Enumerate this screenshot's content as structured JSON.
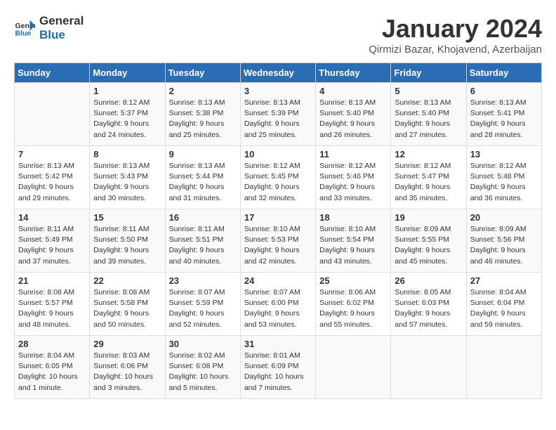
{
  "logo": {
    "line1": "General",
    "line2": "Blue"
  },
  "title": "January 2024",
  "location": "Qirmizi Bazar, Khojavend, Azerbaijan",
  "headers": [
    "Sunday",
    "Monday",
    "Tuesday",
    "Wednesday",
    "Thursday",
    "Friday",
    "Saturday"
  ],
  "weeks": [
    [
      {
        "day": "",
        "sunrise": "",
        "sunset": "",
        "daylight": ""
      },
      {
        "day": "1",
        "sunrise": "Sunrise: 8:12 AM",
        "sunset": "Sunset: 5:37 PM",
        "daylight": "Daylight: 9 hours and 24 minutes."
      },
      {
        "day": "2",
        "sunrise": "Sunrise: 8:13 AM",
        "sunset": "Sunset: 5:38 PM",
        "daylight": "Daylight: 9 hours and 25 minutes."
      },
      {
        "day": "3",
        "sunrise": "Sunrise: 8:13 AM",
        "sunset": "Sunset: 5:39 PM",
        "daylight": "Daylight: 9 hours and 25 minutes."
      },
      {
        "day": "4",
        "sunrise": "Sunrise: 8:13 AM",
        "sunset": "Sunset: 5:40 PM",
        "daylight": "Daylight: 9 hours and 26 minutes."
      },
      {
        "day": "5",
        "sunrise": "Sunrise: 8:13 AM",
        "sunset": "Sunset: 5:40 PM",
        "daylight": "Daylight: 9 hours and 27 minutes."
      },
      {
        "day": "6",
        "sunrise": "Sunrise: 8:13 AM",
        "sunset": "Sunset: 5:41 PM",
        "daylight": "Daylight: 9 hours and 28 minutes."
      }
    ],
    [
      {
        "day": "7",
        "sunrise": "Sunrise: 8:13 AM",
        "sunset": "Sunset: 5:42 PM",
        "daylight": "Daylight: 9 hours and 29 minutes."
      },
      {
        "day": "8",
        "sunrise": "Sunrise: 8:13 AM",
        "sunset": "Sunset: 5:43 PM",
        "daylight": "Daylight: 9 hours and 30 minutes."
      },
      {
        "day": "9",
        "sunrise": "Sunrise: 8:13 AM",
        "sunset": "Sunset: 5:44 PM",
        "daylight": "Daylight: 9 hours and 31 minutes."
      },
      {
        "day": "10",
        "sunrise": "Sunrise: 8:12 AM",
        "sunset": "Sunset: 5:45 PM",
        "daylight": "Daylight: 9 hours and 32 minutes."
      },
      {
        "day": "11",
        "sunrise": "Sunrise: 8:12 AM",
        "sunset": "Sunset: 5:46 PM",
        "daylight": "Daylight: 9 hours and 33 minutes."
      },
      {
        "day": "12",
        "sunrise": "Sunrise: 8:12 AM",
        "sunset": "Sunset: 5:47 PM",
        "daylight": "Daylight: 9 hours and 35 minutes."
      },
      {
        "day": "13",
        "sunrise": "Sunrise: 8:12 AM",
        "sunset": "Sunset: 5:48 PM",
        "daylight": "Daylight: 9 hours and 36 minutes."
      }
    ],
    [
      {
        "day": "14",
        "sunrise": "Sunrise: 8:11 AM",
        "sunset": "Sunset: 5:49 PM",
        "daylight": "Daylight: 9 hours and 37 minutes."
      },
      {
        "day": "15",
        "sunrise": "Sunrise: 8:11 AM",
        "sunset": "Sunset: 5:50 PM",
        "daylight": "Daylight: 9 hours and 39 minutes."
      },
      {
        "day": "16",
        "sunrise": "Sunrise: 8:11 AM",
        "sunset": "Sunset: 5:51 PM",
        "daylight": "Daylight: 9 hours and 40 minutes."
      },
      {
        "day": "17",
        "sunrise": "Sunrise: 8:10 AM",
        "sunset": "Sunset: 5:53 PM",
        "daylight": "Daylight: 9 hours and 42 minutes."
      },
      {
        "day": "18",
        "sunrise": "Sunrise: 8:10 AM",
        "sunset": "Sunset: 5:54 PM",
        "daylight": "Daylight: 9 hours and 43 minutes."
      },
      {
        "day": "19",
        "sunrise": "Sunrise: 8:09 AM",
        "sunset": "Sunset: 5:55 PM",
        "daylight": "Daylight: 9 hours and 45 minutes."
      },
      {
        "day": "20",
        "sunrise": "Sunrise: 8:09 AM",
        "sunset": "Sunset: 5:56 PM",
        "daylight": "Daylight: 9 hours and 46 minutes."
      }
    ],
    [
      {
        "day": "21",
        "sunrise": "Sunrise: 8:08 AM",
        "sunset": "Sunset: 5:57 PM",
        "daylight": "Daylight: 9 hours and 48 minutes."
      },
      {
        "day": "22",
        "sunrise": "Sunrise: 8:08 AM",
        "sunset": "Sunset: 5:58 PM",
        "daylight": "Daylight: 9 hours and 50 minutes."
      },
      {
        "day": "23",
        "sunrise": "Sunrise: 8:07 AM",
        "sunset": "Sunset: 5:59 PM",
        "daylight": "Daylight: 9 hours and 52 minutes."
      },
      {
        "day": "24",
        "sunrise": "Sunrise: 8:07 AM",
        "sunset": "Sunset: 6:00 PM",
        "daylight": "Daylight: 9 hours and 53 minutes."
      },
      {
        "day": "25",
        "sunrise": "Sunrise: 8:06 AM",
        "sunset": "Sunset: 6:02 PM",
        "daylight": "Daylight: 9 hours and 55 minutes."
      },
      {
        "day": "26",
        "sunrise": "Sunrise: 8:05 AM",
        "sunset": "Sunset: 6:03 PM",
        "daylight": "Daylight: 9 hours and 57 minutes."
      },
      {
        "day": "27",
        "sunrise": "Sunrise: 8:04 AM",
        "sunset": "Sunset: 6:04 PM",
        "daylight": "Daylight: 9 hours and 59 minutes."
      }
    ],
    [
      {
        "day": "28",
        "sunrise": "Sunrise: 8:04 AM",
        "sunset": "Sunset: 6:05 PM",
        "daylight": "Daylight: 10 hours and 1 minute."
      },
      {
        "day": "29",
        "sunrise": "Sunrise: 8:03 AM",
        "sunset": "Sunset: 6:06 PM",
        "daylight": "Daylight: 10 hours and 3 minutes."
      },
      {
        "day": "30",
        "sunrise": "Sunrise: 8:02 AM",
        "sunset": "Sunset: 6:08 PM",
        "daylight": "Daylight: 10 hours and 5 minutes."
      },
      {
        "day": "31",
        "sunrise": "Sunrise: 8:01 AM",
        "sunset": "Sunset: 6:09 PM",
        "daylight": "Daylight: 10 hours and 7 minutes."
      },
      {
        "day": "",
        "sunrise": "",
        "sunset": "",
        "daylight": ""
      },
      {
        "day": "",
        "sunrise": "",
        "sunset": "",
        "daylight": ""
      },
      {
        "day": "",
        "sunrise": "",
        "sunset": "",
        "daylight": ""
      }
    ]
  ]
}
